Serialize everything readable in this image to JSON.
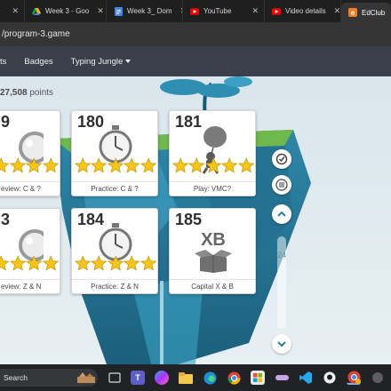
{
  "browser": {
    "tabs": [
      {
        "label": "Week 3 - Goo",
        "icon": "google-drive-icon"
      },
      {
        "label": "Week 3_ Dom",
        "icon": "google-docs-icon"
      },
      {
        "label": "YouTube",
        "icon": "youtube-icon"
      },
      {
        "label": "Video details",
        "icon": "youtube-icon"
      },
      {
        "label": "EdClub",
        "icon": "edclub-icon",
        "active": true
      }
    ],
    "url": "/program-3.game"
  },
  "nav": {
    "items": [
      "ts",
      "Badges"
    ],
    "dropdown_label": "Typing Jungle"
  },
  "score": {
    "value": "27,508",
    "unit": "points"
  },
  "cards": [
    {
      "number": "9",
      "label": "eview: C & ?",
      "icon": "magnifier-icon"
    },
    {
      "number": "180",
      "label": "Practice: C & ?",
      "icon": "stopwatch-icon"
    },
    {
      "number": "181",
      "label": "Play: VMC?",
      "icon": "balloon-character-icon"
    },
    {
      "number": "3",
      "label": "eview: Z & N",
      "icon": "magnifier-icon"
    },
    {
      "number": "184",
      "label": "Practice: Z & N",
      "icon": "stopwatch-icon"
    },
    {
      "number": "185",
      "label": "Capital X & B",
      "icon": "box-icon",
      "icon_text": "XB"
    }
  ],
  "sidebar": {
    "level": "24"
  },
  "taskbar": {
    "search_label": "Search"
  },
  "colors": {
    "star": "#f5c518",
    "nav": "#394049",
    "taskbar": "#202226"
  }
}
